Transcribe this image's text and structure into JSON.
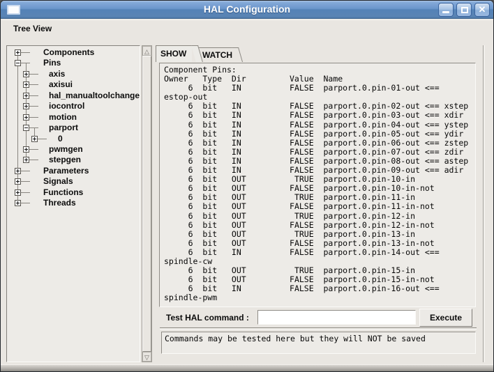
{
  "window": {
    "title": "HAL Configuration",
    "controls": [
      {
        "name": "minimize"
      },
      {
        "name": "maximize"
      },
      {
        "name": "close",
        "glyph": "✕"
      }
    ]
  },
  "menubar": {
    "items": [
      {
        "label": "Tree View"
      }
    ]
  },
  "tree": {
    "items": [
      {
        "label": "Components",
        "depth": 0,
        "state": "collapsed"
      },
      {
        "label": "Pins",
        "depth": 0,
        "state": "expanded"
      },
      {
        "label": "axis",
        "depth": 1,
        "state": "collapsed"
      },
      {
        "label": "axisui",
        "depth": 1,
        "state": "collapsed"
      },
      {
        "label": "hal_manualtoolchange",
        "depth": 1,
        "state": "collapsed"
      },
      {
        "label": "iocontrol",
        "depth": 1,
        "state": "collapsed"
      },
      {
        "label": "motion",
        "depth": 1,
        "state": "collapsed"
      },
      {
        "label": "parport",
        "depth": 1,
        "state": "expanded"
      },
      {
        "label": "0",
        "depth": 2,
        "state": "collapsed"
      },
      {
        "label": "pwmgen",
        "depth": 1,
        "state": "collapsed"
      },
      {
        "label": "stepgen",
        "depth": 1,
        "state": "collapsed"
      },
      {
        "label": "Parameters",
        "depth": 0,
        "state": "collapsed"
      },
      {
        "label": "Signals",
        "depth": 0,
        "state": "collapsed"
      },
      {
        "label": "Functions",
        "depth": 0,
        "state": "collapsed"
      },
      {
        "label": "Threads",
        "depth": 0,
        "state": "collapsed"
      }
    ]
  },
  "notebook": {
    "tabs": [
      {
        "label": "SHOW",
        "active": true
      },
      {
        "label": "WATCH",
        "active": false
      }
    ]
  },
  "show": {
    "lines": [
      "Component Pins:",
      "Owner   Type  Dir         Value  Name",
      "     6  bit   IN          FALSE  parport.0.pin-01-out <==",
      "estop-out",
      "     6  bit   IN          FALSE  parport.0.pin-02-out <== xstep",
      "     6  bit   IN          FALSE  parport.0.pin-03-out <== xdir",
      "     6  bit   IN          FALSE  parport.0.pin-04-out <== ystep",
      "     6  bit   IN          FALSE  parport.0.pin-05-out <== ydir",
      "     6  bit   IN          FALSE  parport.0.pin-06-out <== zstep",
      "     6  bit   IN          FALSE  parport.0.pin-07-out <== zdir",
      "     6  bit   IN          FALSE  parport.0.pin-08-out <== astep",
      "     6  bit   IN          FALSE  parport.0.pin-09-out <== adir",
      "     6  bit   OUT          TRUE  parport.0.pin-10-in",
      "     6  bit   OUT         FALSE  parport.0.pin-10-in-not",
      "     6  bit   OUT          TRUE  parport.0.pin-11-in",
      "     6  bit   OUT         FALSE  parport.0.pin-11-in-not",
      "     6  bit   OUT          TRUE  parport.0.pin-12-in",
      "     6  bit   OUT         FALSE  parport.0.pin-12-in-not",
      "     6  bit   OUT          TRUE  parport.0.pin-13-in",
      "     6  bit   OUT         FALSE  parport.0.pin-13-in-not",
      "     6  bit   IN          FALSE  parport.0.pin-14-out <==",
      "spindle-cw",
      "     6  bit   OUT          TRUE  parport.0.pin-15-in",
      "     6  bit   OUT         FALSE  parport.0.pin-15-in-not",
      "     6  bit   IN          FALSE  parport.0.pin-16-out <==",
      "spindle-pwm"
    ]
  },
  "command": {
    "label": "Test HAL command :",
    "value": "",
    "execute_label": "Execute"
  },
  "message": {
    "text": "Commands may be tested here but they will NOT be saved"
  },
  "colors": {
    "titlebar_top": "#84a9d8",
    "titlebar_bottom": "#4d77a8",
    "title_text": "#ffffff",
    "window_bg": "#e9e6e1",
    "panel_bg": "#edebe7",
    "text": "#060606"
  }
}
